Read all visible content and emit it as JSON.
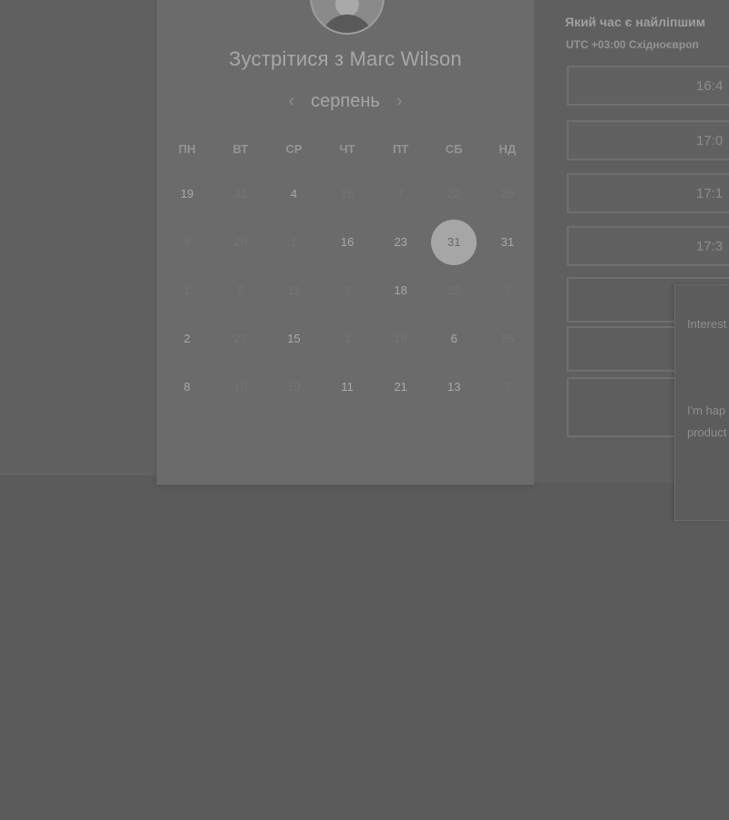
{
  "meeting": {
    "title": "Зустрітися з Marc Wilson"
  },
  "calendar": {
    "month": "серпень",
    "prev_icon": "‹",
    "next_icon": "›",
    "weekdays": [
      "ПН",
      "ВТ",
      "СР",
      "ЧТ",
      "ПТ",
      "СБ",
      "НД"
    ],
    "weeks": [
      [
        {
          "day": "19",
          "state": "on"
        },
        {
          "day": "31",
          "state": "off"
        },
        {
          "day": "4",
          "state": "on"
        },
        {
          "day": "16",
          "state": "off"
        },
        {
          "day": "7",
          "state": "off"
        },
        {
          "day": "22",
          "state": "off"
        },
        {
          "day": "20",
          "state": "off"
        }
      ],
      [
        {
          "day": "8",
          "state": "off"
        },
        {
          "day": "20",
          "state": "off"
        },
        {
          "day": "1",
          "state": "off"
        },
        {
          "day": "16",
          "state": "on"
        },
        {
          "day": "23",
          "state": "on"
        },
        {
          "day": "31",
          "state": "sel"
        },
        {
          "day": "31",
          "state": "on"
        }
      ],
      [
        {
          "day": "1",
          "state": "off"
        },
        {
          "day": "2",
          "state": "off"
        },
        {
          "day": "11",
          "state": "off"
        },
        {
          "day": "3",
          "state": "off"
        },
        {
          "day": "18",
          "state": "on"
        },
        {
          "day": "22",
          "state": "off"
        },
        {
          "day": "7",
          "state": "off"
        }
      ],
      [
        {
          "day": "2",
          "state": "on"
        },
        {
          "day": "27",
          "state": "off"
        },
        {
          "day": "15",
          "state": "on"
        },
        {
          "day": "1",
          "state": "off"
        },
        {
          "day": "19",
          "state": "off"
        },
        {
          "day": "6",
          "state": "on"
        },
        {
          "day": "26",
          "state": "off"
        }
      ],
      [
        {
          "day": "8",
          "state": "on"
        },
        {
          "day": "10",
          "state": "off"
        },
        {
          "day": "19",
          "state": "off"
        },
        {
          "day": "11",
          "state": "on"
        },
        {
          "day": "21",
          "state": "on"
        },
        {
          "day": "13",
          "state": "on"
        },
        {
          "day": "7",
          "state": "off"
        }
      ]
    ]
  },
  "times": {
    "question": "Який час є найліпшим",
    "timezone": "UTC +03:00 Східноєвроп",
    "slots": [
      "16:4",
      "17:0",
      "17:1",
      "17:3",
      "",
      "",
      ""
    ]
  },
  "tooltip": {
    "p1": "Interest Manag departi",
    "p2": "I'm hap insight use our improve product"
  }
}
